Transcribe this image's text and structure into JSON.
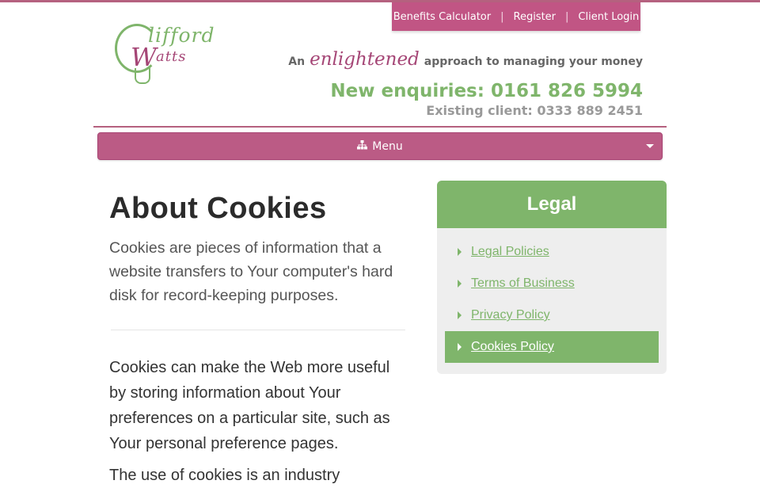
{
  "top_links": {
    "benefits": "Benefits Calculator",
    "separator": "|",
    "register": "Register",
    "login": "Client Login"
  },
  "logo": {
    "line1": "lifford",
    "initial": "W",
    "line2": "atts"
  },
  "tagline": {
    "prefix": "An",
    "script": "enlightened",
    "suffix": "approach to managing your money"
  },
  "phones": {
    "new": "New enquiries: 0161 826 5994",
    "existing": "Existing client: 0333 889 2451"
  },
  "menu": {
    "label": "Menu",
    "icon": "sitemap-icon"
  },
  "content": {
    "title": "About Cookies",
    "lead": "Cookies are pieces of information that a website transfers to Your computer's hard disk for record-keeping purposes.",
    "paragraph1": "Cookies can make the Web more useful by storing information about Your preferences on a particular site, such as Your personal preference pages.",
    "paragraph2": "The use of cookies is an industry"
  },
  "sidebar": {
    "title": "Legal",
    "items": [
      {
        "label": "Legal Policies",
        "active": false
      },
      {
        "label": "Terms of Business",
        "active": false
      },
      {
        "label": "Privacy Policy",
        "active": false
      },
      {
        "label": "Cookies Policy",
        "active": true
      }
    ]
  },
  "colors": {
    "brand_pink": "#bb5b85",
    "brand_green": "#7fb56b"
  }
}
